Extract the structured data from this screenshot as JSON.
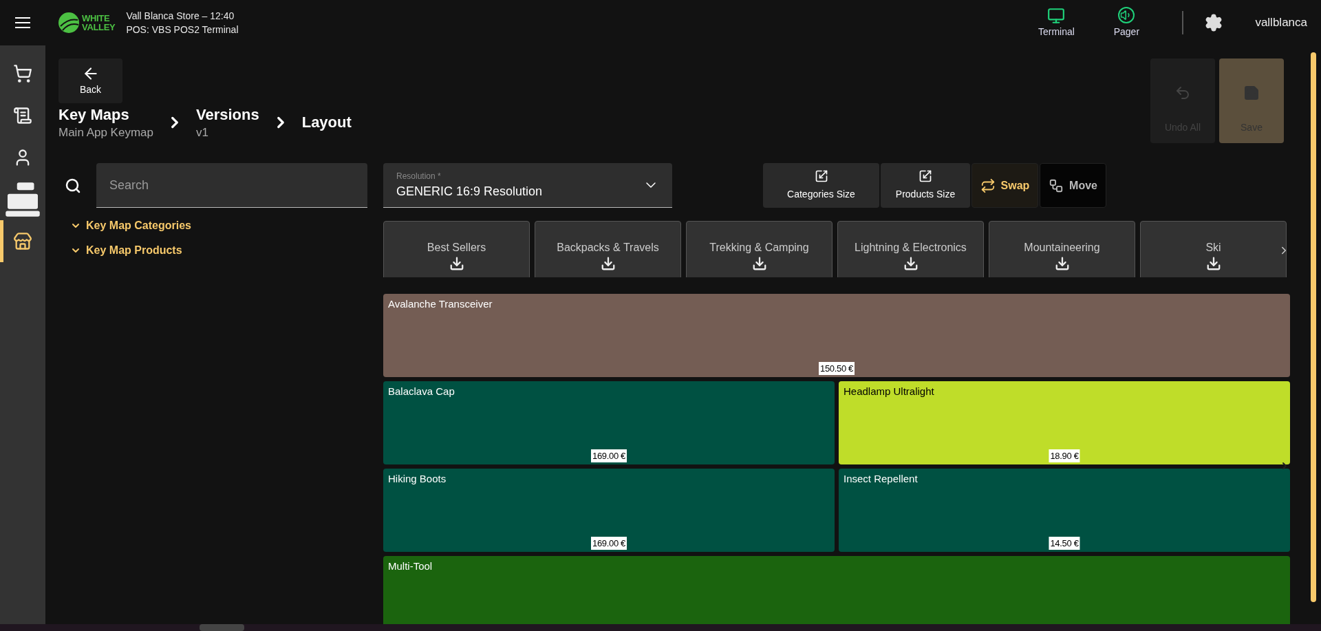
{
  "header": {
    "brand": {
      "line_1": "WHITE",
      "line_2": "VALLEY"
    },
    "store": "Vall Blanca Store – 12:40",
    "pos": "POS: VBS POS2 Terminal",
    "devices": [
      {
        "kind": "terminal",
        "label": "Terminal"
      },
      {
        "kind": "pager",
        "label": "Pager"
      }
    ],
    "user": "vallblanca"
  },
  "sidebar": {
    "items": [
      {
        "kind": "cart",
        "selected": false
      },
      {
        "kind": "receipt",
        "selected": false
      },
      {
        "kind": "user",
        "selected": false
      },
      {
        "kind": "register",
        "selected": false
      },
      {
        "kind": "store",
        "selected": true
      }
    ]
  },
  "back_button": {
    "label": "Back"
  },
  "breadcrumb": [
    {
      "title": "Key Maps",
      "subtitle": "Main App Keymap"
    },
    {
      "title": "Versions",
      "subtitle": "v1"
    },
    {
      "title": "Layout"
    }
  ],
  "actions": [
    {
      "kind": "undo",
      "label": "Undo All",
      "disabled": true
    },
    {
      "kind": "save",
      "label": "Save",
      "disabled": true
    }
  ],
  "search": {
    "placeholder": "Search"
  },
  "tree": [
    {
      "label": "Key Map Categories",
      "expanded": true
    },
    {
      "label": "Key Map Products",
      "expanded": true
    }
  ],
  "resolution": {
    "label": "Resolution *",
    "value": "GENERIC 16:9 Resolution"
  },
  "tools": [
    {
      "kind": "size",
      "label": "Categories Size",
      "selected": false
    },
    {
      "kind": "size",
      "label": "Products Size",
      "selected": false
    },
    {
      "kind": "swap",
      "label": "Swap",
      "selected": true
    },
    {
      "kind": "move",
      "label": "Move",
      "selected": false
    }
  ],
  "categories": [
    "Best Sellers",
    "Backpacks & Travels",
    "Trekking & Camping",
    "Lightning & Electronics",
    "Mountaineering",
    "Ski"
  ],
  "products": [
    {
      "kind": "wide",
      "name": "Avalanche Transceiver",
      "price": "150.50 €",
      "color": "#745d54"
    },
    {
      "kind": "narrow",
      "name": "Balaclava Cap",
      "price": "169.00 €",
      "color": "#005142"
    },
    {
      "kind": "narrow",
      "name": "Headlamp Ultralight",
      "price": "18.90 €",
      "color": "#bfdd29"
    },
    {
      "kind": "narrow",
      "name": "Hiking Boots",
      "price": "169.00 €",
      "color": "#005142"
    },
    {
      "kind": "narrow",
      "name": "Insect Repellent",
      "price": "14.50 €",
      "color": "#005142"
    },
    {
      "kind": "wide",
      "name": "Multi-Tool",
      "color": "#1b640e"
    }
  ]
}
